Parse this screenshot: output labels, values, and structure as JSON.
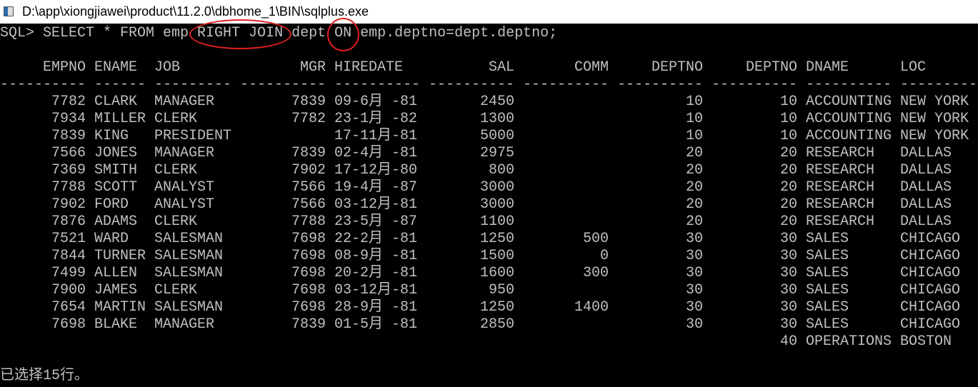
{
  "window": {
    "title": "D:\\app\\xiongjiawei\\product\\11.2.0\\dbhome_1\\BIN\\sqlplus.exe",
    "icon": "console-app-icon"
  },
  "console": {
    "command_line": "SQL> SELECT * FROM emp RIGHT JOIN dept ON emp.deptno=dept.deptno;",
    "highlight_color": "#e02020",
    "highlighted": [
      "RIGHT JOIN",
      "ON"
    ],
    "columns": [
      "EMPNO",
      "ENAME",
      "JOB",
      "MGR",
      "HIREDATE",
      "SAL",
      "COMM",
      "DEPTNO",
      "DEPTNO",
      "DNAME",
      "LOC"
    ],
    "rows": [
      [
        "7782",
        "CLARK",
        "MANAGER",
        "7839",
        "09-6月 -81",
        "2450",
        "",
        "10",
        "10",
        "ACCOUNTING",
        "NEW YORK"
      ],
      [
        "7934",
        "MILLER",
        "CLERK",
        "7782",
        "23-1月 -82",
        "1300",
        "",
        "10",
        "10",
        "ACCOUNTING",
        "NEW YORK"
      ],
      [
        "7839",
        "KING",
        "PRESIDENT",
        "",
        "17-11月-81",
        "5000",
        "",
        "10",
        "10",
        "ACCOUNTING",
        "NEW YORK"
      ],
      [
        "7566",
        "JONES",
        "MANAGER",
        "7839",
        "02-4月 -81",
        "2975",
        "",
        "20",
        "20",
        "RESEARCH",
        "DALLAS"
      ],
      [
        "7369",
        "SMITH",
        "CLERK",
        "7902",
        "17-12月-80",
        "800",
        "",
        "20",
        "20",
        "RESEARCH",
        "DALLAS"
      ],
      [
        "7788",
        "SCOTT",
        "ANALYST",
        "7566",
        "19-4月 -87",
        "3000",
        "",
        "20",
        "20",
        "RESEARCH",
        "DALLAS"
      ],
      [
        "7902",
        "FORD",
        "ANALYST",
        "7566",
        "03-12月-81",
        "3000",
        "",
        "20",
        "20",
        "RESEARCH",
        "DALLAS"
      ],
      [
        "7876",
        "ADAMS",
        "CLERK",
        "7788",
        "23-5月 -87",
        "1100",
        "",
        "20",
        "20",
        "RESEARCH",
        "DALLAS"
      ],
      [
        "7521",
        "WARD",
        "SALESMAN",
        "7698",
        "22-2月 -81",
        "1250",
        "500",
        "30",
        "30",
        "SALES",
        "CHICAGO"
      ],
      [
        "7844",
        "TURNER",
        "SALESMAN",
        "7698",
        "08-9月 -81",
        "1500",
        "0",
        "30",
        "30",
        "SALES",
        "CHICAGO"
      ],
      [
        "7499",
        "ALLEN",
        "SALESMAN",
        "7698",
        "20-2月 -81",
        "1600",
        "300",
        "30",
        "30",
        "SALES",
        "CHICAGO"
      ],
      [
        "7900",
        "JAMES",
        "CLERK",
        "7698",
        "03-12月-81",
        "950",
        "",
        "30",
        "30",
        "SALES",
        "CHICAGO"
      ],
      [
        "7654",
        "MARTIN",
        "SALESMAN",
        "7698",
        "28-9月 -81",
        "1250",
        "1400",
        "30",
        "30",
        "SALES",
        "CHICAGO"
      ],
      [
        "7698",
        "BLAKE",
        "MANAGER",
        "7839",
        "01-5月 -81",
        "2850",
        "",
        "30",
        "30",
        "SALES",
        "CHICAGO"
      ],
      [
        "",
        "",
        "",
        "",
        "",
        "",
        "",
        "",
        "40",
        "OPERATIONS",
        "BOSTON"
      ]
    ],
    "footer": "已选择15行。"
  }
}
